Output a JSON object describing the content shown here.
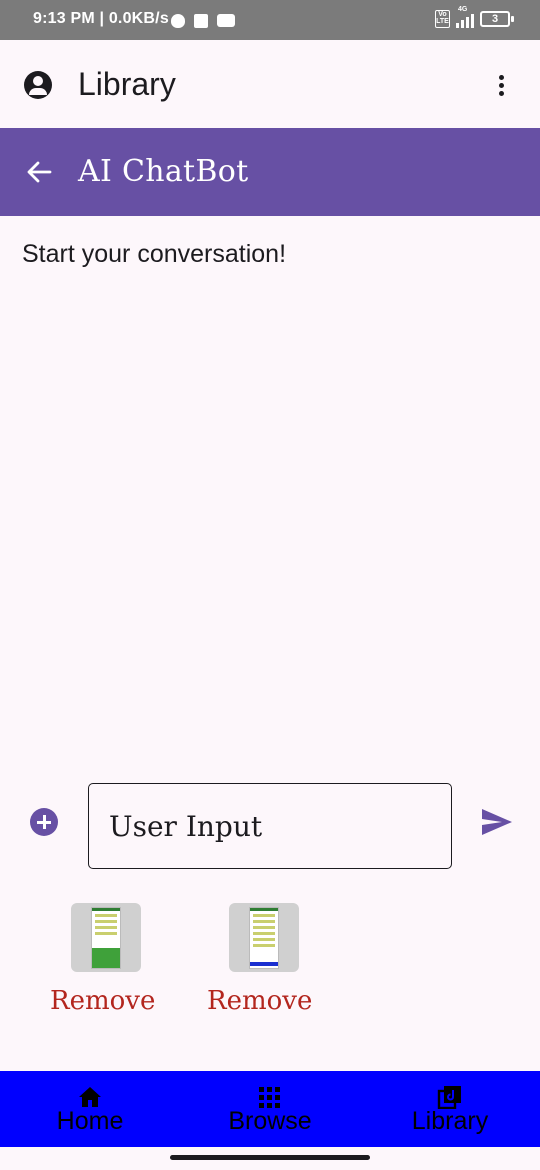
{
  "status_bar": {
    "time": "9:13 PM | 0.0KB/s",
    "volte": "Vo LTE",
    "network": "4G",
    "battery": "3",
    "icons": [
      "shield-icon",
      "bag-icon",
      "youtube-icon",
      "volte-icon",
      "signal-icon",
      "battery-icon"
    ]
  },
  "app_bar": {
    "title": "Library",
    "icons": [
      "account-circle-icon",
      "more-vert-icon"
    ]
  },
  "chat_header": {
    "title": "AI ChatBot",
    "back_icon": "arrow-back-icon"
  },
  "chat": {
    "empty_message": "Start your conversation!"
  },
  "composer": {
    "input_placeholder": "User Input",
    "add_icon": "add-circle-icon",
    "send_icon": "send-icon"
  },
  "attachments": [
    {
      "remove_label": "Remove"
    },
    {
      "remove_label": "Remove"
    }
  ],
  "bottom_nav": {
    "items": [
      {
        "label": "Home",
        "icon": "home-icon"
      },
      {
        "label": "Browse",
        "icon": "grid-icon"
      },
      {
        "label": "Library",
        "icon": "library-icon"
      }
    ]
  },
  "colors": {
    "primary": "#6750a4",
    "error": "#b3261e",
    "nav_background": "#0000ff",
    "status_bar": "#7b7b7b",
    "background": "#fdf7fb"
  }
}
